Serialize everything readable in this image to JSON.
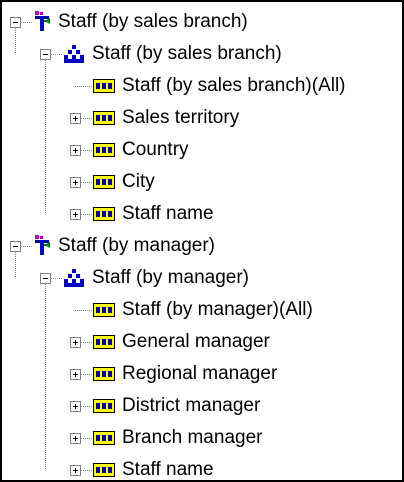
{
  "tree": {
    "roots": [
      {
        "label": "Staff (by sales branch)",
        "icon": "dimension-icon",
        "expanded": true,
        "hierarchy": {
          "label": "Staff (by sales branch)",
          "icon": "hierarchy-icon",
          "expanded": true,
          "levels": [
            {
              "label": "Staff (by sales branch)(All)",
              "icon": "level-icon",
              "expander": "none"
            },
            {
              "label": "Sales territory",
              "icon": "level-icon",
              "expander": "plus"
            },
            {
              "label": "Country",
              "icon": "level-icon",
              "expander": "plus"
            },
            {
              "label": "City",
              "icon": "level-icon",
              "expander": "plus"
            },
            {
              "label": "Staff name",
              "icon": "level-icon",
              "expander": "plus"
            }
          ]
        }
      },
      {
        "label": "Staff (by manager)",
        "icon": "dimension-icon",
        "expanded": true,
        "hierarchy": {
          "label": "Staff (by manager)",
          "icon": "hierarchy-icon",
          "expanded": true,
          "levels": [
            {
              "label": "Staff (by manager)(All)",
              "icon": "level-icon",
              "expander": "none"
            },
            {
              "label": "General manager",
              "icon": "level-icon",
              "expander": "plus"
            },
            {
              "label": "Regional manager",
              "icon": "level-icon",
              "expander": "plus"
            },
            {
              "label": "District manager",
              "icon": "level-icon",
              "expander": "plus"
            },
            {
              "label": "Branch manager",
              "icon": "level-icon",
              "expander": "plus"
            },
            {
              "label": "Staff name",
              "icon": "level-icon",
              "expander": "plus"
            }
          ]
        }
      }
    ]
  },
  "colors": {
    "connector": "#808080",
    "dimension_blue": "#0000c0",
    "dimension_magenta": "#c000c0",
    "dimension_green": "#008000",
    "level_yellow": "#ffff00",
    "level_blue": "#0000a0"
  }
}
